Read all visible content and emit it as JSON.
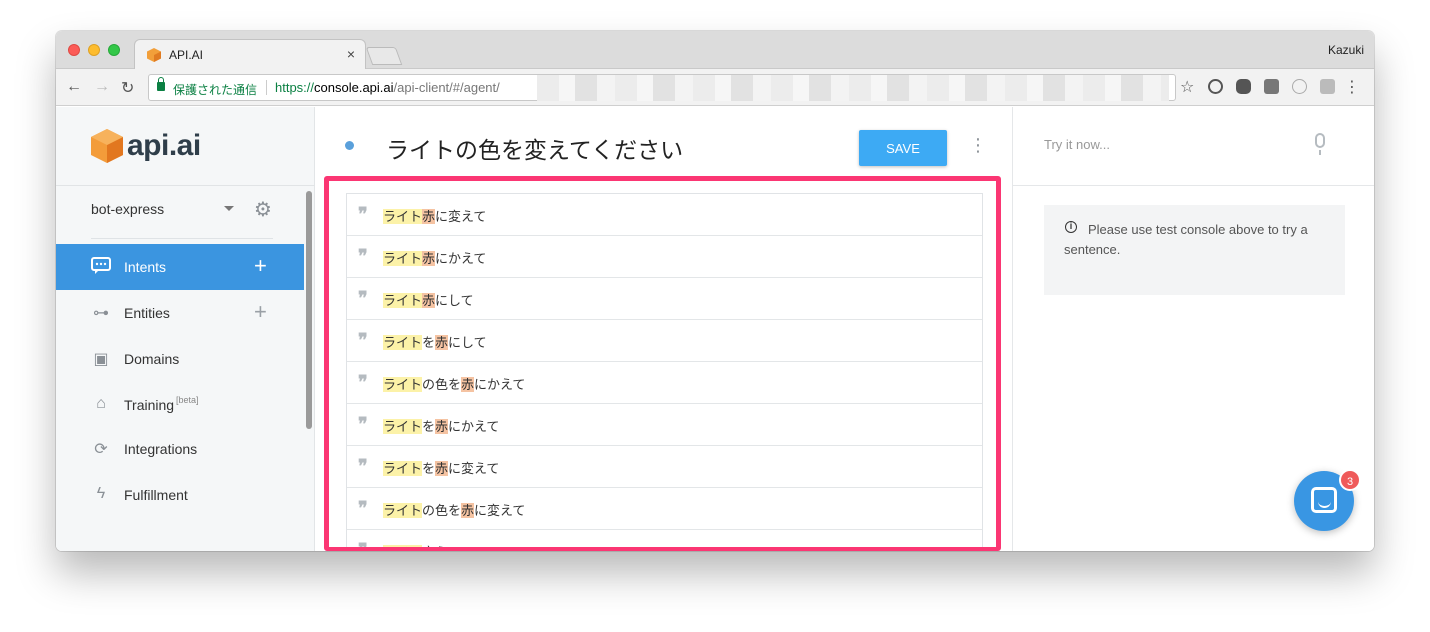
{
  "browser": {
    "tab_title": "API.AI",
    "tab_close": "×",
    "profile_name": "Kazuki",
    "secure_label": "保護された通信",
    "url_scheme": "https://",
    "url_host": "console.api.ai",
    "url_path": "/api-client/#/agent/"
  },
  "sidebar": {
    "logo_text": "api.ai",
    "agent_name": "bot-express",
    "items": [
      {
        "label": "Intents",
        "icon": "chat-bubble-icon",
        "has_add": true,
        "active": true
      },
      {
        "label": "Entities",
        "icon": "hierarchy-icon",
        "has_add": true,
        "active": false
      },
      {
        "label": "Domains",
        "icon": "book-icon",
        "has_add": false,
        "active": false
      },
      {
        "label": "Training",
        "icon": "graduation-cap-icon",
        "has_add": false,
        "active": false,
        "suffix": "[beta]"
      },
      {
        "label": "Integrations",
        "icon": "sync-icon",
        "has_add": false,
        "active": false
      },
      {
        "label": "Fulfillment",
        "icon": "lightning-icon",
        "has_add": false,
        "active": false
      }
    ]
  },
  "main": {
    "intent_title": "ライトの色を変えてください",
    "save_label": "SAVE",
    "user_says": [
      [
        {
          "t": "ライト",
          "h": "y"
        },
        {
          "t": "赤",
          "h": "o"
        },
        {
          "t": "に変えて",
          "h": ""
        }
      ],
      [
        {
          "t": "ライト",
          "h": "y"
        },
        {
          "t": "赤",
          "h": "o"
        },
        {
          "t": "にかえて",
          "h": ""
        }
      ],
      [
        {
          "t": "ライト",
          "h": "y"
        },
        {
          "t": "赤",
          "h": "o"
        },
        {
          "t": "にして",
          "h": ""
        }
      ],
      [
        {
          "t": "ライト",
          "h": "y"
        },
        {
          "t": "を",
          "h": ""
        },
        {
          "t": "赤",
          "h": "o"
        },
        {
          "t": "にして",
          "h": ""
        }
      ],
      [
        {
          "t": "ライト",
          "h": "y"
        },
        {
          "t": "の色を",
          "h": ""
        },
        {
          "t": "赤",
          "h": "o"
        },
        {
          "t": "にかえて",
          "h": ""
        }
      ],
      [
        {
          "t": "ライト",
          "h": "y"
        },
        {
          "t": "を",
          "h": ""
        },
        {
          "t": "赤",
          "h": "o"
        },
        {
          "t": "にかえて",
          "h": ""
        }
      ],
      [
        {
          "t": "ライト",
          "h": "y"
        },
        {
          "t": "を",
          "h": ""
        },
        {
          "t": "赤",
          "h": "o"
        },
        {
          "t": "に変えて",
          "h": ""
        }
      ],
      [
        {
          "t": "ライト",
          "h": "y"
        },
        {
          "t": "の色を",
          "h": ""
        },
        {
          "t": "赤",
          "h": "o"
        },
        {
          "t": "に変えて",
          "h": ""
        }
      ],
      [
        {
          "t": "ライト",
          "h": "y"
        },
        {
          "t": "変えて",
          "h": ""
        }
      ]
    ]
  },
  "right_panel": {
    "try_placeholder": "Try it now...",
    "info_text": "Please use test console above to try a sentence.",
    "chat_badge": "3"
  },
  "colors": {
    "accent": "#3b95e0",
    "save": "#3daaf4",
    "highlight_frame": "#fb3673",
    "entity_yellow": "#fcf2a8",
    "entity_orange": "#f5c3a2"
  }
}
